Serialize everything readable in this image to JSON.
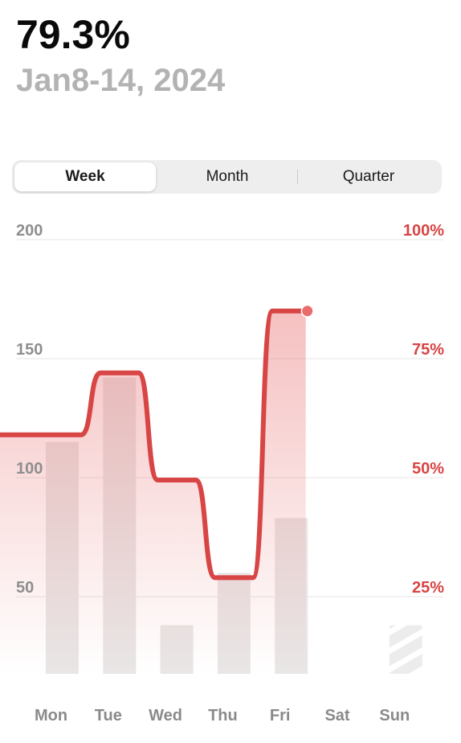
{
  "header": {
    "value": "79.3%",
    "date_range": "Jan8-14, 2024"
  },
  "segmented_control": {
    "options": [
      "Week",
      "Month",
      "Quarter"
    ],
    "selected": "Week"
  },
  "colors": {
    "accent": "#d84545",
    "bar": "#e9e6e6",
    "grid": "#e5e5e5"
  },
  "chart_data": {
    "type": "bar",
    "categories": [
      "Mon",
      "Tue",
      "Wed",
      "Thu",
      "Fri",
      "Sat",
      "Sun"
    ],
    "left_axis": {
      "ticks": [
        "200",
        "150",
        "100",
        "50"
      ],
      "ylim": [
        0,
        200
      ]
    },
    "right_axis": {
      "ticks": [
        "100%",
        "75%",
        "50%",
        "25%"
      ],
      "ylim": [
        0,
        100
      ]
    },
    "series": [
      {
        "type": "bar",
        "values": [
          115,
          142,
          38,
          60,
          83,
          null,
          38
        ],
        "placeholder_index": 6
      },
      {
        "type": "line",
        "axis": "right",
        "values": [
          59,
          72,
          49.5,
          29,
          85,
          null,
          null
        ]
      }
    ],
    "grid": true,
    "x_range": [
      0.5,
      7.5
    ]
  }
}
